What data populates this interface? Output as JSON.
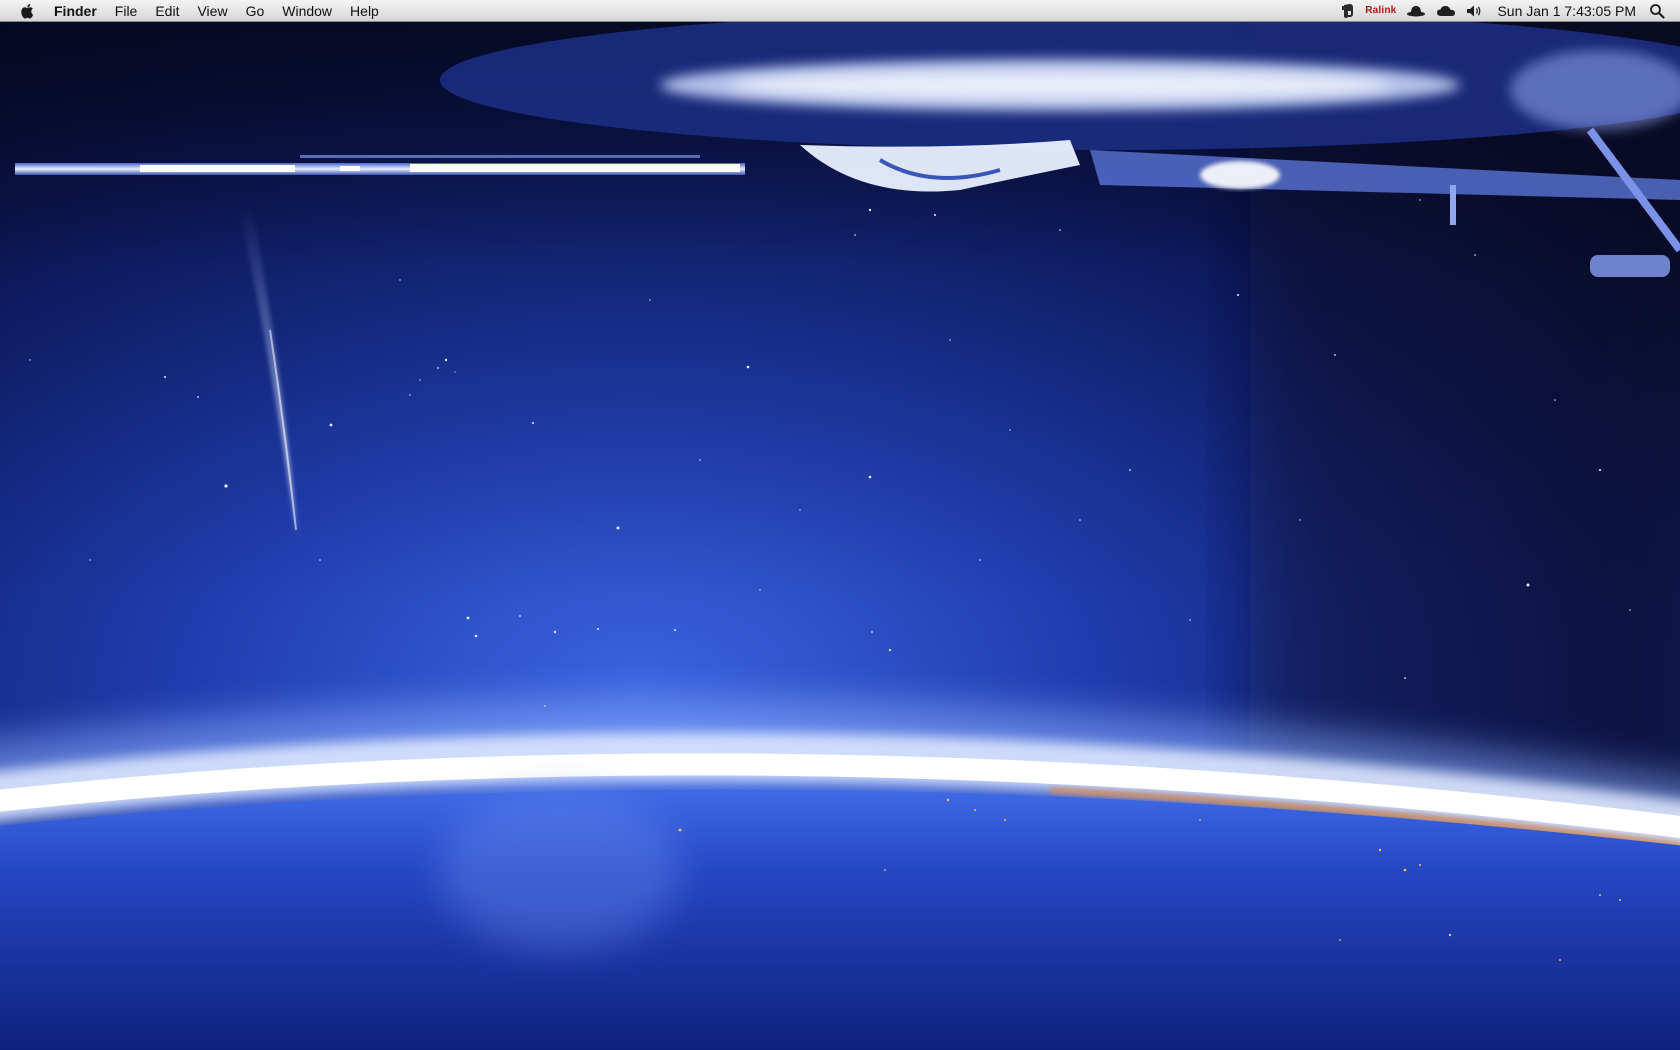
{
  "menubar": {
    "apple_icon": "apple-logo-icon",
    "app_name": "Finder",
    "menus": [
      "File",
      "Edit",
      "View",
      "Go",
      "Window",
      "Help"
    ],
    "status_items": {
      "evernote_icon": "evernote-elephant-icon",
      "ralink_label": "Ralink",
      "hat_icon": "hat-icon",
      "cloud_icon": "cloud-icon",
      "volume_icon": "speaker-volume-icon",
      "spotlight_icon": "spotlight-search-icon"
    },
    "clock": "Sun Jan 1  7:43:05 PM"
  },
  "desktop": {
    "wallpaper": "space-station-over-earth-with-comet"
  },
  "colors": {
    "menubar_top": "#f4f4f4",
    "menubar_bottom": "#d6d6d6",
    "space_dark": "#0a1038",
    "space_blue": "#2b4fc8",
    "earth_glow": "#ffffff",
    "ralink_red": "#b01818"
  }
}
